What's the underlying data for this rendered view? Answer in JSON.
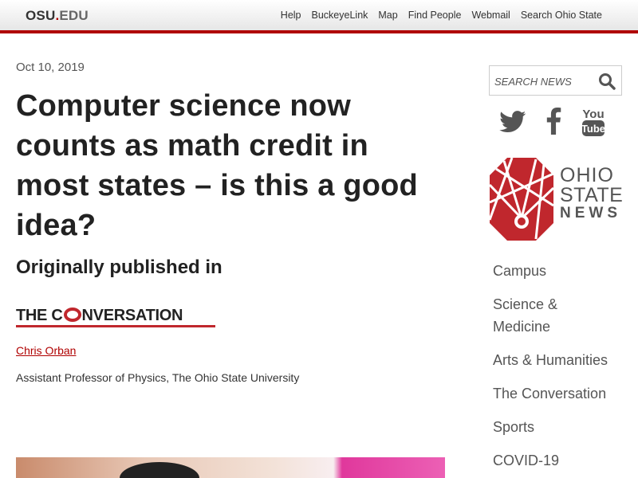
{
  "header": {
    "logo_osu": "OSU",
    "logo_dot": ".",
    "logo_edu": "EDU",
    "links": [
      "Help",
      "BuckeyeLink",
      "Map",
      "Find People",
      "Webmail",
      "Search Ohio State"
    ]
  },
  "article": {
    "date": "Oct 10, 2019",
    "title": "Computer science now counts as math credit in most states – is this a good idea?",
    "published_in": "Originally published in",
    "source_logo": {
      "part1": "THE C",
      "part2": "NVERSATION"
    },
    "author": "Chris Orban",
    "affiliation": "Assistant Professor of Physics, The Ohio State University"
  },
  "sidebar": {
    "search_placeholder": "SEARCH NEWS",
    "social": [
      "twitter-icon",
      "facebook-icon",
      "youtube-icon"
    ],
    "youtube_text": {
      "top": "You",
      "bottom": "Tube"
    },
    "brand": {
      "line1": "OHIO",
      "line2": "STATE",
      "line3": "NEWS"
    },
    "nav": [
      "Campus",
      "Science & Medicine",
      "Arts & Humanities",
      "The Conversation",
      "Sports",
      "COVID-19"
    ]
  },
  "colors": {
    "accent": "#b00000",
    "conversation_red": "#c0272d",
    "logo_red": "#c0272d",
    "text": "#222222"
  }
}
